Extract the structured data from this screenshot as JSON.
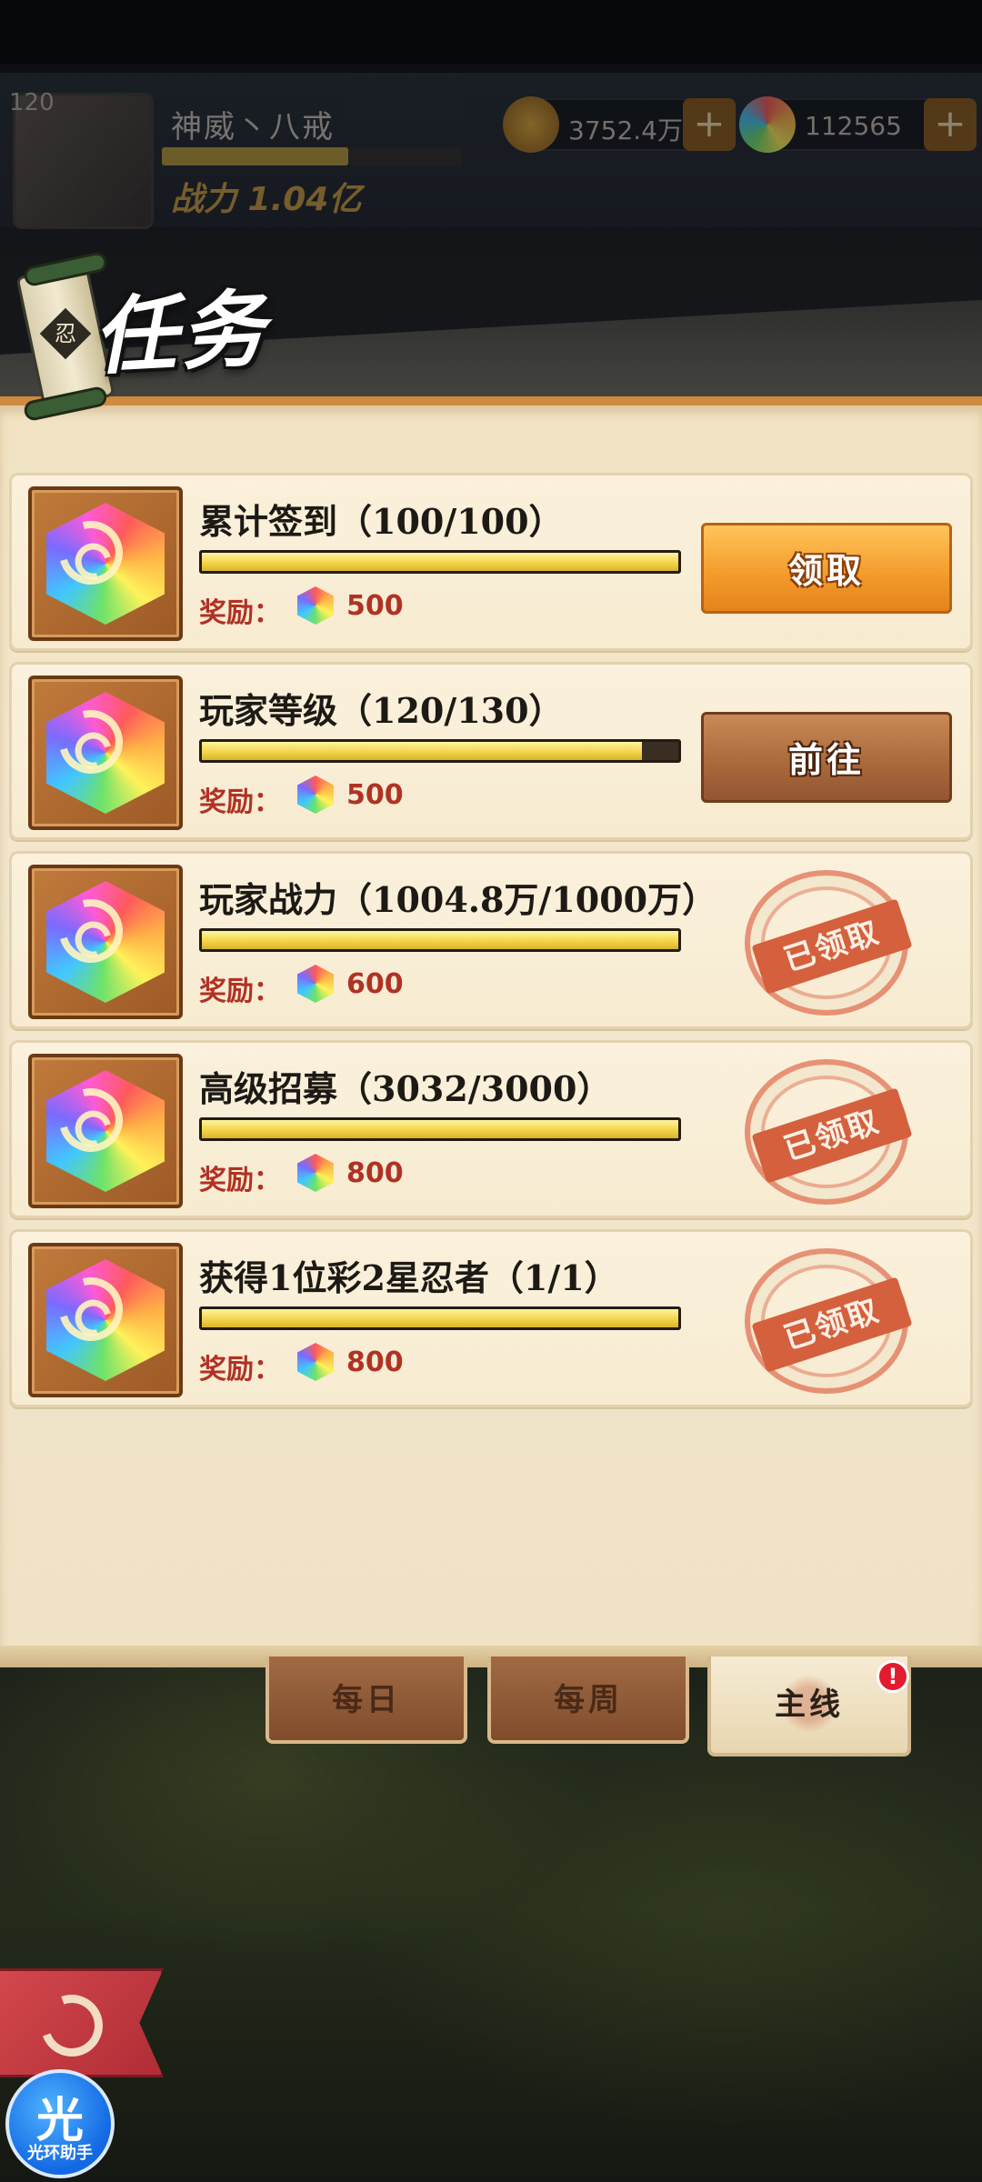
{
  "player": {
    "level": "120",
    "name": "神威丶八戒",
    "power": "战力 1.04亿",
    "coins": "3752.4万",
    "gems": "112565"
  },
  "page": {
    "title": "任务",
    "scroll_glyph": "忍"
  },
  "tasks": [
    {
      "title": "累计签到（100/100）",
      "progress": 1.0,
      "reward_label": "奖励：",
      "reward_value": "500",
      "state": "claim",
      "action_label": "领取"
    },
    {
      "title": "玩家等级（120/130）",
      "progress": 0.923,
      "reward_label": "奖励：",
      "reward_value": "500",
      "state": "go",
      "action_label": "前往"
    },
    {
      "title": "玩家战力（1004.8万/1000万）",
      "progress": 1.0,
      "reward_label": "奖励：",
      "reward_value": "600",
      "state": "claimed",
      "action_label": "已领取"
    },
    {
      "title": "高级招募（3032/3000）",
      "progress": 1.0,
      "reward_label": "奖励：",
      "reward_value": "800",
      "state": "claimed",
      "action_label": "已领取"
    },
    {
      "title": "获得1位彩2星忍者（1/1）",
      "progress": 1.0,
      "reward_label": "奖励：",
      "reward_value": "800",
      "state": "claimed",
      "action_label": "已领取"
    }
  ],
  "tabs": [
    {
      "label": "每日",
      "active": false
    },
    {
      "label": "每周",
      "active": false
    },
    {
      "label": "主线",
      "active": true
    }
  ],
  "alert_badge": "!",
  "helper": {
    "glyph": "光",
    "label": "光环助手"
  },
  "colors": {
    "accent_orange": "#f29a2a",
    "reward_red": "#b03224",
    "stamp_red": "#d4603e",
    "progress_yellow": "#f3d54a"
  }
}
